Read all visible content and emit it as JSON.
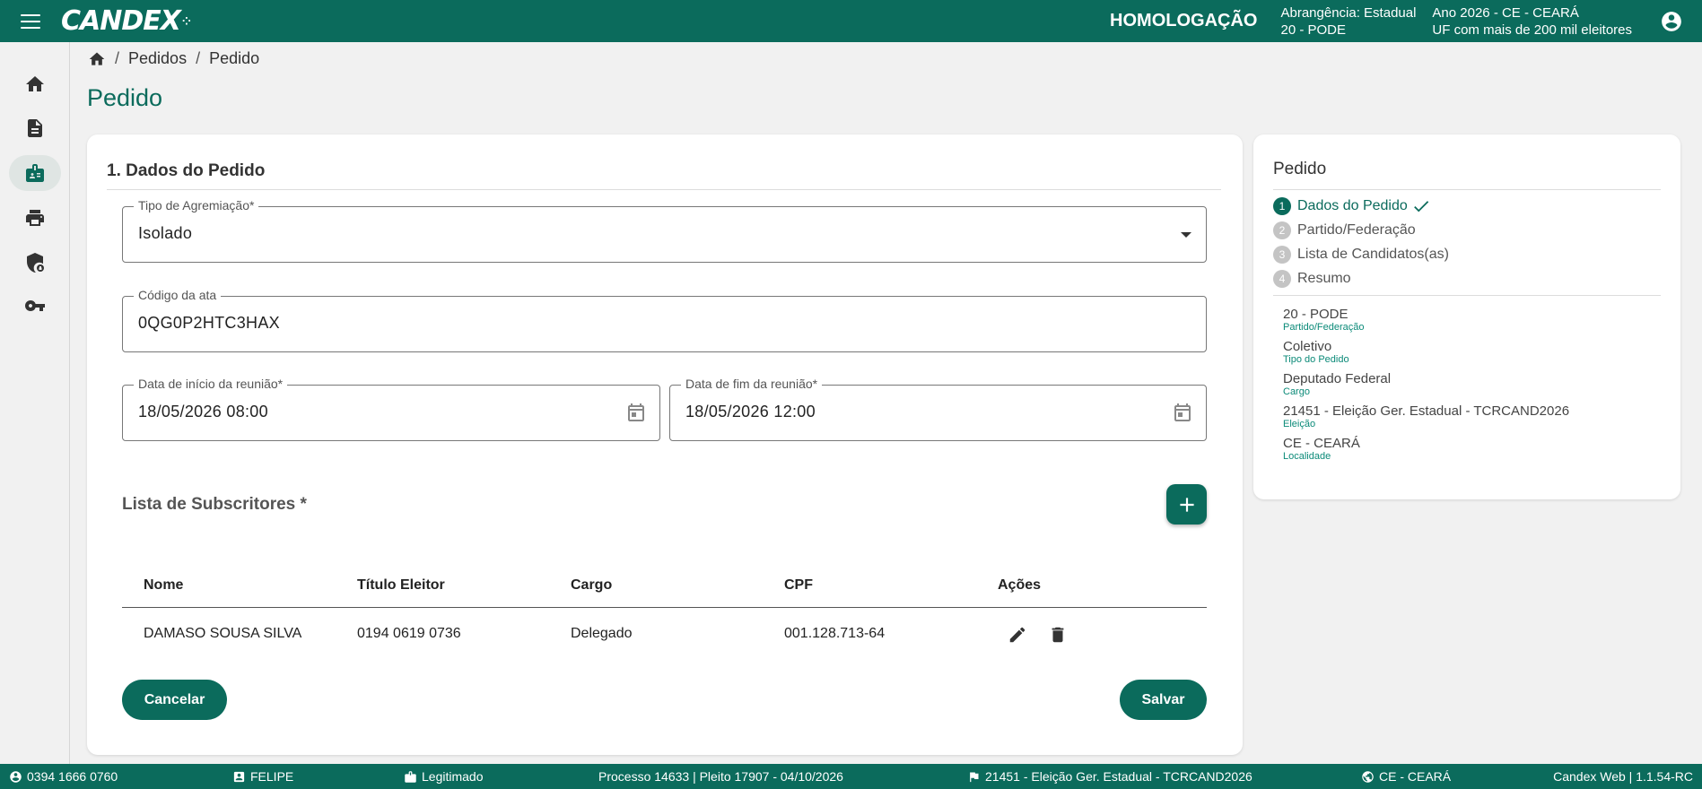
{
  "header": {
    "logo": "CANDEX",
    "environment": "HOMOLOGAÇÃO",
    "scope_line1": "Abrangência: Estadual",
    "scope_line2": "20 - PODE",
    "year_line1": "Ano 2026 - CE - CEARÁ",
    "year_line2": "UF com mais de 200 mil eleitores"
  },
  "breadcrumb": {
    "item1": "Pedidos",
    "item2": "Pedido"
  },
  "page_title": "Pedido",
  "form": {
    "section_title": "1. Dados do Pedido",
    "tipo_label": "Tipo de Agremiação*",
    "tipo_value": "Isolado",
    "codigo_label": "Código da ata",
    "codigo_value": "0QG0P2HTC3HAX",
    "inicio_label": "Data de início da reunião*",
    "inicio_value": "18/05/2026 08:00",
    "fim_label": "Data de fim da reunião*",
    "fim_value": "18/05/2026 12:00",
    "subscritores_title": "Lista de Subscritores *"
  },
  "table": {
    "headers": [
      "Nome",
      "Título Eleitor",
      "Cargo",
      "CPF",
      "Ações"
    ],
    "rows": [
      {
        "nome": "DAMASO SOUSA SILVA",
        "titulo": "0194 0619 0736",
        "cargo": "Delegado",
        "cpf": "001.128.713-64"
      }
    ]
  },
  "buttons": {
    "cancel": "Cancelar",
    "save": "Salvar"
  },
  "side": {
    "title": "Pedido",
    "steps": [
      {
        "num": "1",
        "label": "Dados do Pedido"
      },
      {
        "num": "2",
        "label": "Partido/Federação"
      },
      {
        "num": "3",
        "label": "Lista de Candidatos(as)"
      },
      {
        "num": "4",
        "label": "Resumo"
      }
    ],
    "summary": [
      {
        "value": "20 - PODE",
        "key": "Partido/Federação"
      },
      {
        "value": "Coletivo",
        "key": "Tipo do Pedido"
      },
      {
        "value": "Deputado Federal",
        "key": "Cargo"
      },
      {
        "value": "21451 - Eleição Ger. Estadual - TCRCAND2026",
        "key": "Eleição"
      },
      {
        "value": "CE - CEARÁ",
        "key": "Localidade"
      }
    ]
  },
  "footer": {
    "phone": "0394 1666 0760",
    "user": "FELIPE",
    "status": "Legitimado",
    "process": "Processo 14633 | Pleito 17907 - 04/10/2026",
    "election": "21451 - Eleição Ger. Estadual - TCRCAND2026",
    "locality": "CE - CEARÁ",
    "version": "Candex Web | 1.1.54-RC"
  },
  "colors": {
    "primary": "#0b6b5c",
    "background": "#f1f1f1"
  },
  "icons": [
    "menu-icon",
    "account-circle-icon",
    "home-icon",
    "document-icon",
    "badge-icon",
    "printer-icon",
    "security-icon",
    "key-icon",
    "calendar-icon",
    "add-icon",
    "edit-icon",
    "delete-icon",
    "check-icon",
    "phone-icon",
    "person-icon",
    "briefcase-icon",
    "flag-icon",
    "globe-icon"
  ]
}
